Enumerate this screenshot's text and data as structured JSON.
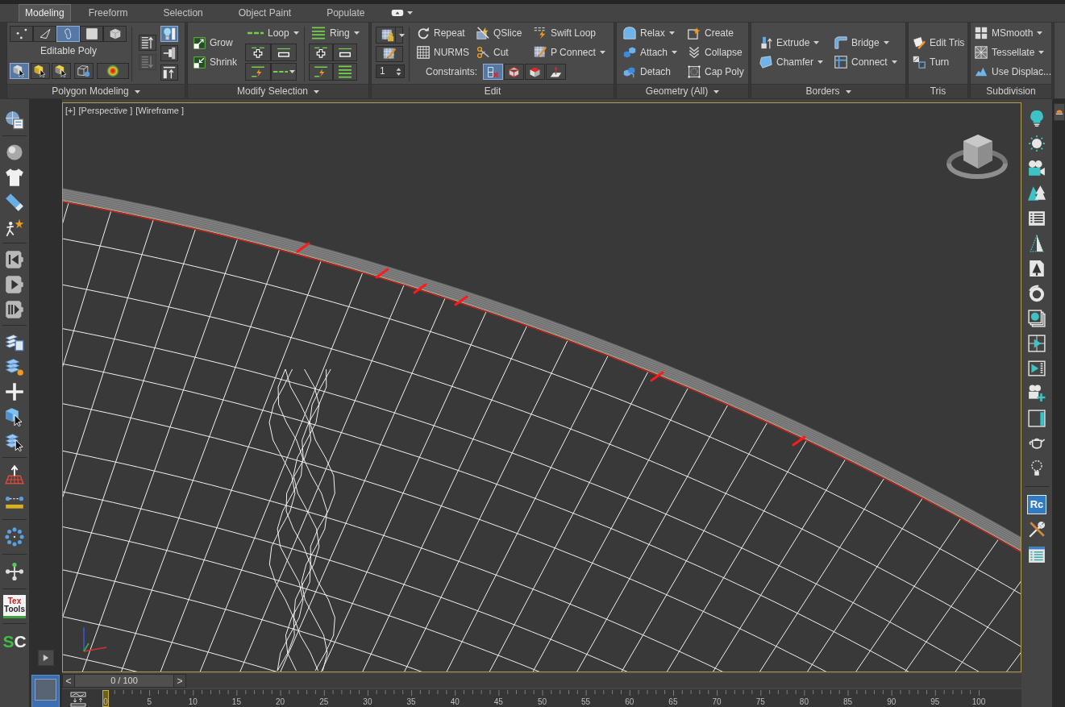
{
  "tabs": [
    {
      "label": "Modeling",
      "selected": true
    },
    {
      "label": "Freeform",
      "selected": false
    },
    {
      "label": "Selection",
      "selected": false
    },
    {
      "label": "Object Paint",
      "selected": false
    },
    {
      "label": "Populate",
      "selected": false
    }
  ],
  "ribbon": {
    "panels": [
      {
        "kind": "polygon_modeling",
        "title": "Polygon Modeling",
        "dropdown": true,
        "object_type": "Editable Poly",
        "subobjects": [
          {
            "kind": "vertex",
            "selected": false
          },
          {
            "kind": "edge",
            "selected": false
          },
          {
            "kind": "border",
            "selected": true
          },
          {
            "kind": "polygon",
            "selected": false
          },
          {
            "kind": "element",
            "selected": false
          }
        ],
        "selection_modes": [
          {
            "kind": "by_vertex",
            "selected": true
          },
          {
            "kind": "ignore_backfacing",
            "selected": false
          },
          {
            "kind": "by_angle",
            "selected": false
          }
        ],
        "stack_tools": [
          {
            "kind": "previous",
            "disabled": false
          },
          {
            "kind": "next",
            "disabled": true
          }
        ],
        "display_toggles": [
          {
            "kind": "cage",
            "selected": true
          },
          {
            "kind": "pin",
            "selected": false
          },
          {
            "kind": "result",
            "selected": false
          }
        ]
      },
      {
        "kind": "modify_selection",
        "title": "Modify Selection",
        "dropdown": true,
        "grow_shrink": [
          {
            "label": "Grow"
          },
          {
            "label": "Shrink"
          }
        ],
        "loop": {
          "label": "Loop",
          "dropdown": true
        },
        "ring": {
          "label": "Ring",
          "dropdown": true
        }
      },
      {
        "kind": "edit",
        "title": "Edit",
        "dropdown": false,
        "spinner": "1",
        "commands": [
          {
            "label": "Repeat",
            "dropdown": false
          },
          {
            "label": "QSlice",
            "dropdown": false
          },
          {
            "label": "Swift Loop",
            "dropdown": false
          },
          {
            "label": "NURMS",
            "dropdown": false
          },
          {
            "label": "Cut",
            "dropdown": false
          },
          {
            "label": "P Connect",
            "dropdown": true
          }
        ],
        "constraints": {
          "label": "Constraints:",
          "options": [
            {
              "kind": "none",
              "selected": true
            },
            {
              "kind": "edge",
              "selected": false
            },
            {
              "kind": "face",
              "selected": false
            },
            {
              "kind": "normal",
              "selected": false
            }
          ]
        }
      },
      {
        "kind": "geometry",
        "title": "Geometry (All)",
        "dropdown": true,
        "commands": [
          {
            "label": "Relax",
            "dropdown": true
          },
          {
            "label": "Create",
            "dropdown": false
          },
          {
            "label": "Attach",
            "dropdown": true
          },
          {
            "label": "Collapse",
            "dropdown": false
          },
          {
            "label": "Detach",
            "dropdown": false
          },
          {
            "label": "Cap Poly",
            "dropdown": false
          }
        ]
      },
      {
        "kind": "borders",
        "title": "Borders",
        "dropdown": true,
        "commands": [
          {
            "label": "Extrude",
            "dropdown": true
          },
          {
            "label": "Bridge",
            "dropdown": true
          },
          {
            "label": "Chamfer",
            "dropdown": true
          },
          {
            "label": "Connect",
            "dropdown": true
          }
        ]
      },
      {
        "kind": "tris",
        "title": "Tris",
        "dropdown": false,
        "commands": [
          {
            "label": "Edit Tris",
            "dropdown": false
          },
          {
            "label": "Turn",
            "dropdown": false
          }
        ]
      },
      {
        "kind": "subdivision",
        "title": "Subdivision",
        "dropdown": false,
        "commands": [
          {
            "label": "MSmooth",
            "dropdown": true
          },
          {
            "label": "Tessellate",
            "dropdown": true
          },
          {
            "label": "Use Displac...",
            "dropdown": false
          }
        ]
      }
    ]
  },
  "left_toolbar": {
    "textools_logo": [
      "Tex",
      "Tools"
    ],
    "script_logo": [
      "S",
      "C"
    ]
  },
  "right_toolbar": {
    "logo": "Rc"
  },
  "viewport": {
    "labels": [
      "[+]",
      "[Perspective ]",
      "[Wireframe ]"
    ]
  },
  "timeline": {
    "slider": {
      "prev": "<",
      "value": "0 / 100",
      "next": ">",
      "level": 0
    },
    "ruler_labels": [
      "0",
      "5",
      "10",
      "15",
      "20",
      "25",
      "30",
      "35",
      "40",
      "45",
      "50",
      "55",
      "60",
      "65",
      "70",
      "75",
      "80",
      "85",
      "90",
      "95",
      "100"
    ]
  }
}
